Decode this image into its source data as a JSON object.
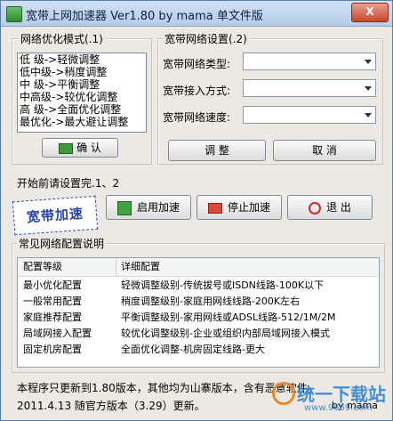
{
  "window": {
    "title": "宽带上网加速器   Ver1.80 by mama 单文件版",
    "close_label": "X"
  },
  "optimization": {
    "group_title": "网络优化模式(.1)",
    "modes": [
      "低    级->轻微调整",
      "低中级->稍度调整",
      "中    级->平衡调整",
      "中高级->较优化调整",
      "高    级->全面优化调整",
      "最优化->最大避让调整"
    ],
    "confirm_label": "确 认"
  },
  "broadband": {
    "group_title": "宽带网络设置(.2)",
    "type_label": "宽带网络类型:",
    "access_label": "宽带接入方式:",
    "speed_label": "宽带网络速度:",
    "adjust_label": "调 整",
    "cancel_label": "取 消"
  },
  "accel": {
    "notice": "开始前请设置完.1、2",
    "logo_text": "宽带加速",
    "enable_label": "启用加速",
    "stop_label": "停止加速",
    "exit_label": "退    出"
  },
  "configs": {
    "group_title": "常见网络配置说明",
    "columns": [
      "配置等级",
      "详细配置"
    ],
    "rows": [
      [
        "最小优化配置",
        "轻微调整级别-传统拔号或ISDN线路-100K以下"
      ],
      [
        "一般常用配置",
        "稍度调整级别-家庭用网线线路-200K左右"
      ],
      [
        "家庭推荐配置",
        "平衡调整级别-家用网线或ADSL线路-512/1M/2M"
      ],
      [
        "局域网接入配置",
        "较优化调整级别-企业或组织内部局域网接入模式"
      ],
      [
        "固定机房配置",
        "全面优化调整-机房固定线路-更大"
      ]
    ]
  },
  "footer": {
    "line1": "本程序只更新到1.80版本，其他均为山寨版本，含有恶意软件。",
    "line2": "2011.4.13 随官方版本（3.29）更新。",
    "by": "by mama"
  },
  "watermark": {
    "text": "统一下载站",
    "url": "www.9669.com"
  }
}
